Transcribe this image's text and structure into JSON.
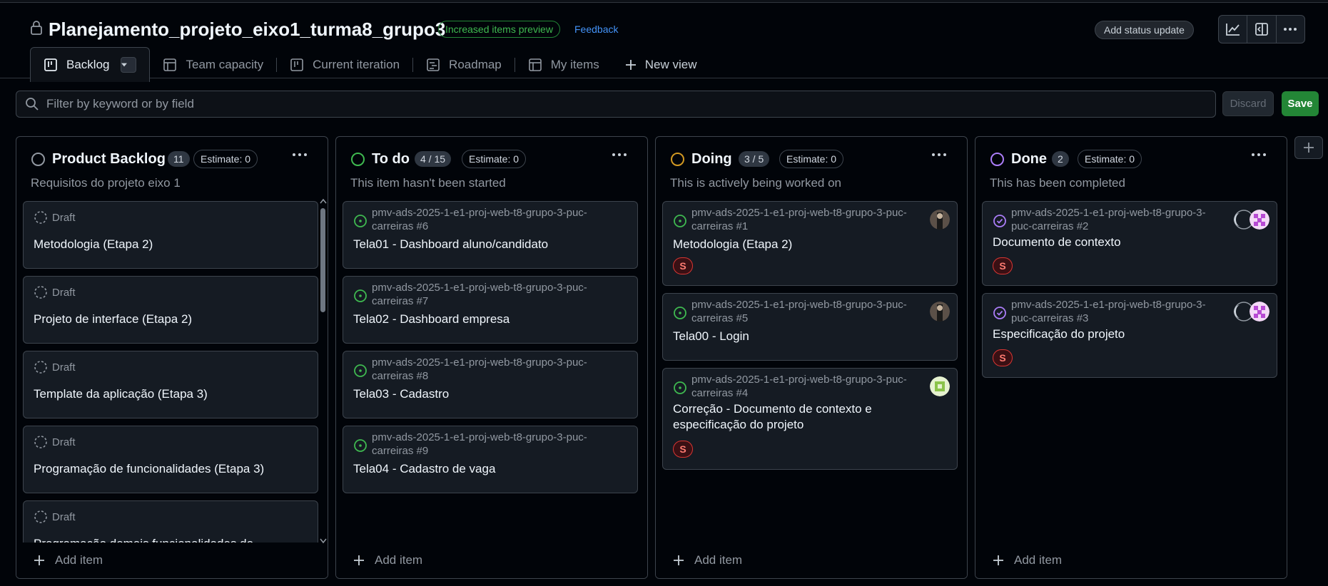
{
  "project": {
    "title": "Planejamento_projeto_eixo1_turma8_grupo3",
    "preview_badge": "Increased items preview",
    "feedback": "Feedback",
    "status_update": "Add status update"
  },
  "tabs": [
    {
      "label": "Backlog",
      "icon": "board-icon",
      "active": true
    },
    {
      "label": "Team capacity",
      "icon": "table-icon"
    },
    {
      "label": "Current iteration",
      "icon": "board-icon"
    },
    {
      "label": "Roadmap",
      "icon": "roadmap-icon"
    },
    {
      "label": "My items",
      "icon": "table-icon"
    },
    {
      "label": "New view",
      "icon": "plus-icon"
    }
  ],
  "filter": {
    "placeholder": "Filter by keyword or by field"
  },
  "actions": {
    "discard": "Discard",
    "save": "Save"
  },
  "colors": {
    "green": "#3fb950",
    "orange": "#d29922",
    "purple": "#ab7df8",
    "gray": "#9198a1",
    "red": "#f85149"
  },
  "columns": [
    {
      "title": "Product Backlog",
      "count": "11",
      "estimate": "Estimate: 0",
      "description": "Requisitos do projeto eixo 1",
      "add_item": "Add item",
      "cards": [
        {
          "draft": "Draft",
          "title": "Metodologia (Etapa 2)"
        },
        {
          "draft": "Draft",
          "title": "Projeto de interface (Etapa 2)"
        },
        {
          "draft": "Draft",
          "title": "Template da aplicação (Etapa 3)"
        },
        {
          "draft": "Draft",
          "title": "Programação de funcionalidades (Etapa 3)"
        },
        {
          "draft": "Draft",
          "title": "Programação demais funcionalidades do"
        }
      ]
    },
    {
      "title": "To do",
      "count": "4 / 15",
      "estimate": "Estimate: 0",
      "description": "This item hasn't been started",
      "add_item": "Add item",
      "cards": [
        {
          "repo": "pmv-ads-2025-1-e1-proj-web-t8-grupo-3-puc-carreiras #6",
          "title": "Tela01 - Dashboard aluno/candidato"
        },
        {
          "repo": "pmv-ads-2025-1-e1-proj-web-t8-grupo-3-puc-carreiras #7",
          "title": "Tela02 - Dashboard empresa"
        },
        {
          "repo": "pmv-ads-2025-1-e1-proj-web-t8-grupo-3-puc-carreiras #8",
          "title": "Tela03 - Cadastro"
        },
        {
          "repo": "pmv-ads-2025-1-e1-proj-web-t8-grupo-3-puc-carreiras #9",
          "title": "Tela04 - Cadastro de vaga"
        }
      ]
    },
    {
      "title": "Doing",
      "count": "3 / 5",
      "estimate": "Estimate: 0",
      "description": "This is actively being worked on",
      "add_item": "Add item",
      "cards": [
        {
          "repo": "pmv-ads-2025-1-e1-proj-web-t8-grupo-3-puc-carreiras #1",
          "title": "Metodologia (Etapa 2)",
          "label": "S"
        },
        {
          "repo": "pmv-ads-2025-1-e1-proj-web-t8-grupo-3-puc-carreiras #5",
          "title": "Tela00 - Login"
        },
        {
          "repo": "pmv-ads-2025-1-e1-proj-web-t8-grupo-3-puc-carreiras #4",
          "title": "Correção - Documento de contexto e especificação do projeto",
          "label": "S"
        }
      ]
    },
    {
      "title": "Done",
      "count": "2",
      "estimate": "Estimate: 0",
      "description": "This has been completed",
      "add_item": "Add item",
      "cards": [
        {
          "repo": "pmv-ads-2025-1-e1-proj-web-t8-grupo-3-puc-carreiras #2",
          "title": "Documento de contexto",
          "label": "S"
        },
        {
          "repo": "pmv-ads-2025-1-e1-proj-web-t8-grupo-3-puc-carreiras #3",
          "title": "Especificação do projeto",
          "label": "S"
        }
      ]
    }
  ]
}
